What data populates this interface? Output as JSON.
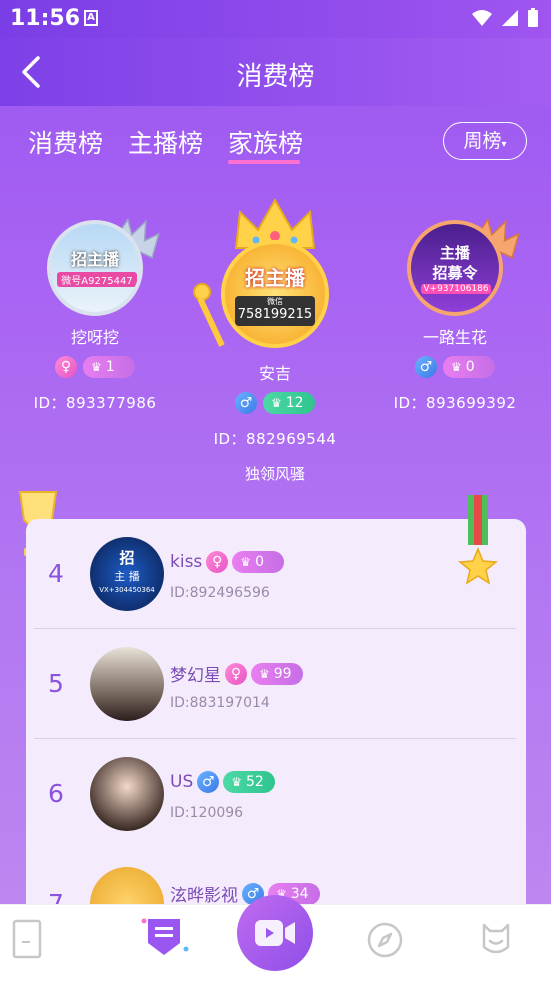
{
  "status": {
    "time": "11:56",
    "a_icon": "A"
  },
  "header": {
    "title": "消费榜"
  },
  "tabs": [
    {
      "label": "消费榜"
    },
    {
      "label": "主播榜"
    },
    {
      "label": "家族榜"
    }
  ],
  "period": {
    "label": "周榜"
  },
  "podium": {
    "first": {
      "name": "安吉",
      "id_label": "ID：882969544",
      "level": "12",
      "gender": "male",
      "slogan": "独领风骚",
      "avatar_text_top": "招主播",
      "avatar_text_mid": "微信",
      "avatar_text_code": "758199215"
    },
    "second": {
      "name": "挖呀挖",
      "id_label": "ID：893377986",
      "level": "1",
      "gender": "female",
      "avatar_text_top": "招主播",
      "avatar_text_code": "微号A9275447"
    },
    "third": {
      "name": "一路生花",
      "id_label": "ID：893699392",
      "level": "0",
      "gender": "male",
      "avatar_text_top": "主播",
      "avatar_text_mid": "招募令",
      "avatar_text_code": "V+937106186"
    }
  },
  "list": [
    {
      "rank": "4",
      "name": "kiss",
      "gender": "female",
      "level": "0",
      "id_label": "ID:892496596",
      "avatar_text_top": "招",
      "avatar_text_mid": "主 播",
      "avatar_text_code": "VX+304450364"
    },
    {
      "rank": "5",
      "name": "梦幻星",
      "gender": "female",
      "level": "99",
      "id_label": "ID:883197014"
    },
    {
      "rank": "6",
      "name": "US",
      "gender": "male",
      "level": "52",
      "id_label": "ID:120096"
    },
    {
      "rank": "7",
      "name": "泫晔影视",
      "gender": "male",
      "level": "34"
    }
  ],
  "colors": {
    "accent": "#9a56f0",
    "pink": "#ff6fd0",
    "gold": "#ffd24a"
  }
}
